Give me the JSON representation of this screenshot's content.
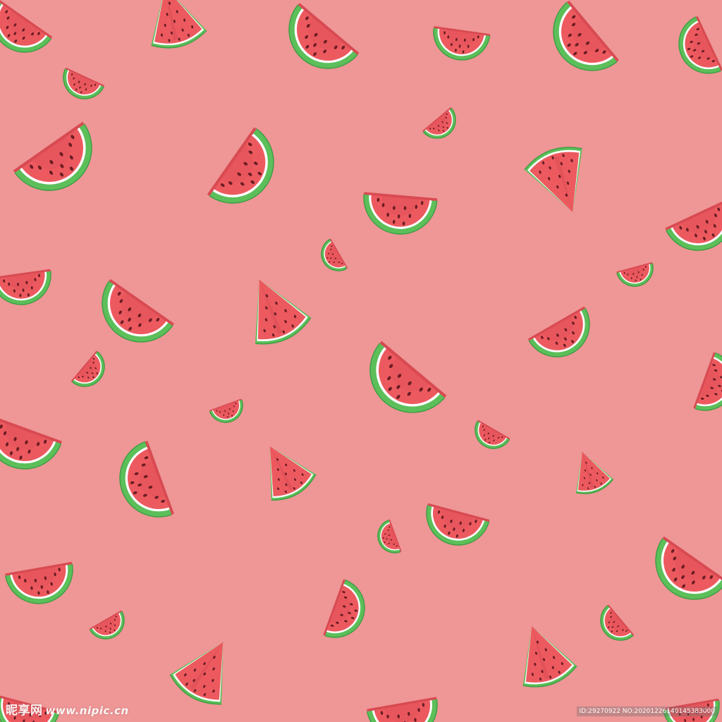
{
  "background_color": "#ef9696",
  "colors": {
    "flesh": "#ec5a5f",
    "flesh_shade": "#d84a52",
    "rind_white": "#ffffff",
    "rind_green": "#5cbf5a",
    "rind_dark": "#3f9f45",
    "seed": "#6b1d24"
  },
  "pattern": {
    "item_icon": "watermelon-slice-icon",
    "slice_count": 40
  },
  "watermark": {
    "logo_text": "昵享网",
    "site_text": "www.nipic.cn",
    "id_text": "ID:29270922 NO:20201226140145383000"
  }
}
